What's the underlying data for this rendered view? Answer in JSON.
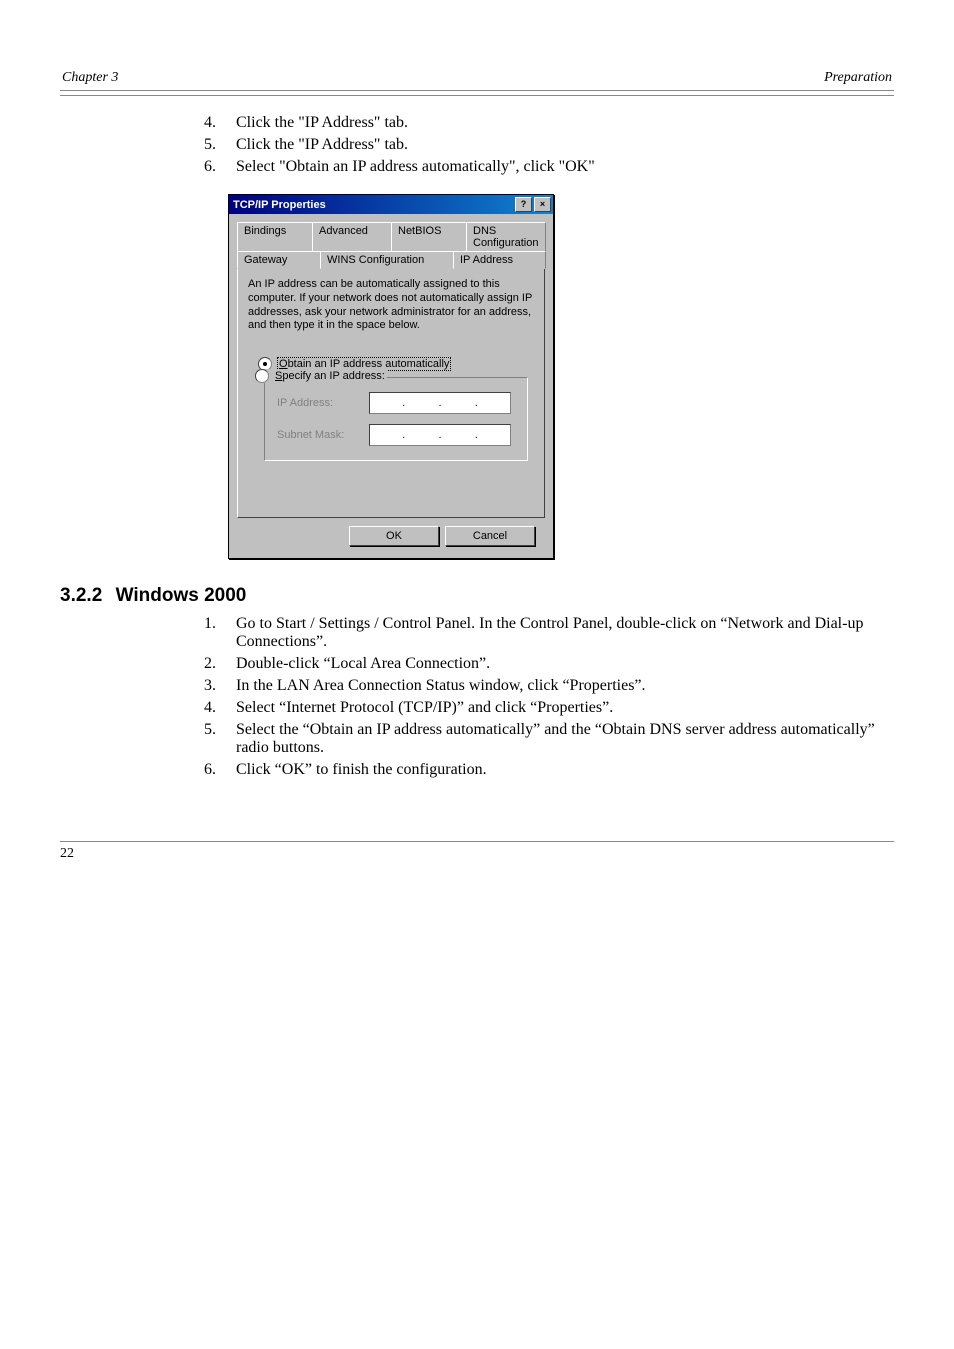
{
  "header": {
    "left": "Chapter 3",
    "right": "Preparation"
  },
  "steps_a": [
    {
      "n": 4,
      "text": "Click the \"IP Address\" tab."
    },
    {
      "n": 5,
      "text": "Click the \"IP Address\" tab."
    },
    {
      "n": 6,
      "text": "Select \"Obtain an IP address automatically\", click \"OK\""
    }
  ],
  "dialog": {
    "title": "TCP/IP Properties",
    "tabs_back": [
      "Bindings",
      "Advanced",
      "NetBIOS",
      "DNS Configuration"
    ],
    "tabs_front": [
      "Gateway",
      "WINS Configuration",
      "IP Address"
    ],
    "explain": "An IP address can be automatically assigned to this computer. If your network does not automatically assign IP addresses, ask your network administrator for an address, and then type it in the space below.",
    "radio_auto": "Obtain an IP address automatically",
    "radio_spec": "Specify an IP address:",
    "lbl_ip": "IP Address:",
    "lbl_mask": "Subnet Mask:",
    "ok": "OK",
    "cancel": "Cancel"
  },
  "section": {
    "num": "3.2.2",
    "title": "Windows 2000"
  },
  "steps_b": [
    {
      "text": "Go to Start / Settings / Control Panel. In the Control Panel, double-click on \"Network and Dial-up Connections\"."
    },
    {
      "text": "Double-click \"Local Area Connection\"."
    },
    {
      "text": "In the LAN Area Connection Status window, click \"Properties\"."
    },
    {
      "text": "Select \"Internet Protocol (TCP/IP)\" and click \"Properties\"."
    },
    {
      "text": "Select the \"Obtain an IP address automatically\" and the \"Obtain DNS server address automatically\" radio buttons."
    },
    {
      "text": "Click \"OK\" to finish the configuration."
    }
  ],
  "footer": {
    "left": "22",
    "right": ""
  }
}
